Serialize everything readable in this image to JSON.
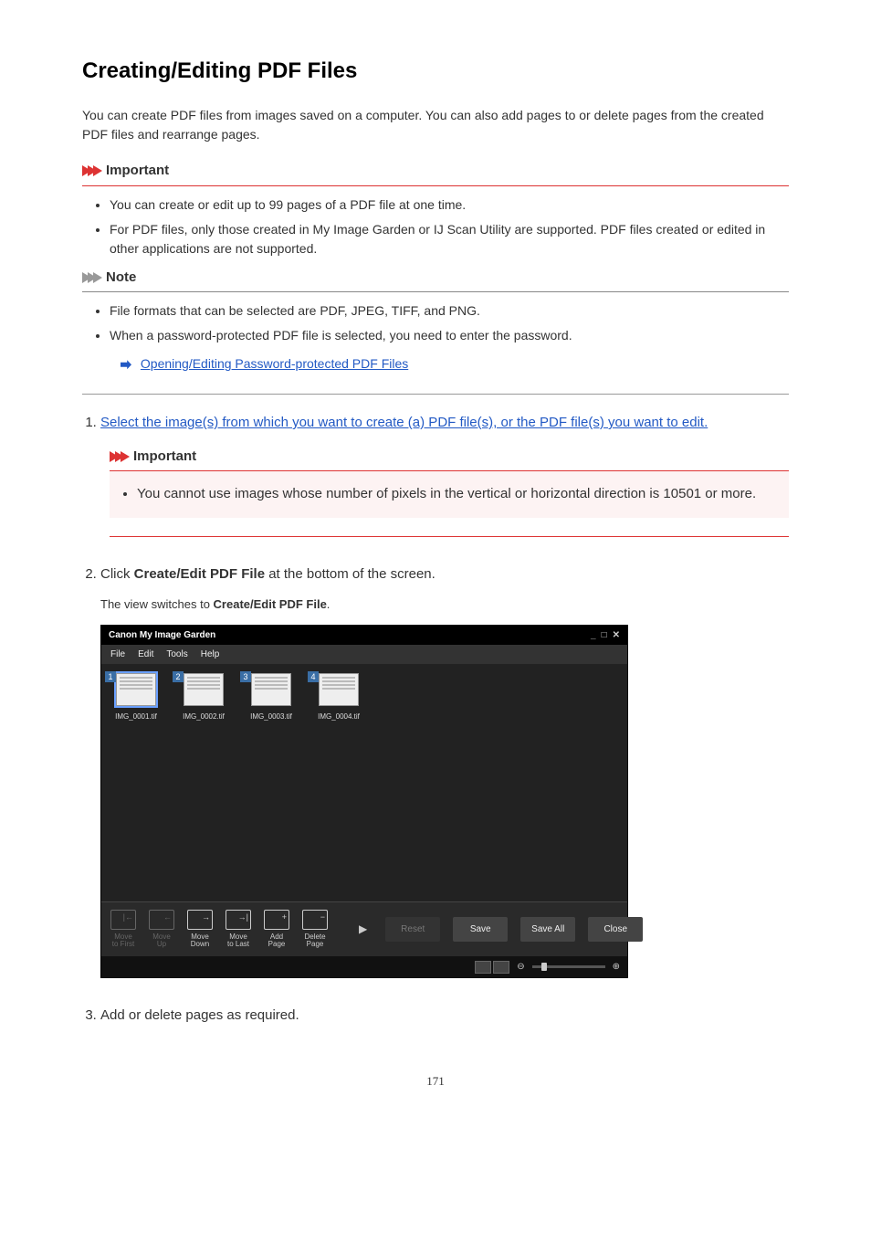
{
  "title": "Creating/Editing PDF Files",
  "intro": "You can create PDF files from images saved on a computer. You can also add pages to or delete pages from the created PDF files and rearrange pages.",
  "important": {
    "heading": "Important",
    "items": [
      "You can create or edit up to 99 pages of a PDF file at one time.",
      "For PDF files, only those created in My Image Garden or IJ Scan Utility are supported. PDF files created or edited in other applications are not supported."
    ]
  },
  "note": {
    "heading": "Note",
    "items": [
      "File formats that can be selected are PDF, JPEG, TIFF, and PNG.",
      "When a password-protected PDF file is selected, you need to enter the password."
    ],
    "link": "Opening/Editing Password-protected PDF Files"
  },
  "steps": {
    "s1": {
      "text": "Select the image(s) from which you want to create (a) PDF file(s), or the PDF file(s) you want to edit.",
      "important_heading": "Important",
      "important_item": "You cannot use images whose number of pixels in the vertical or horizontal direction is 10501 or more."
    },
    "s2": {
      "prefix": "Click ",
      "bold1": "Create/Edit PDF File",
      "suffix": " at the bottom of the screen.",
      "sub_prefix": "The view switches to ",
      "sub_bold": "Create/Edit PDF File",
      "sub_suffix": "."
    },
    "s3": {
      "text": "Add or delete pages as required."
    }
  },
  "app": {
    "title": "Canon My Image Garden",
    "menu": {
      "file": "File",
      "edit": "Edit",
      "tools": "Tools",
      "help": "Help"
    },
    "thumbs": [
      {
        "num": "1",
        "name": "IMG_0001.tif"
      },
      {
        "num": "2",
        "name": "IMG_0002.tif"
      },
      {
        "num": "3",
        "name": "IMG_0003.tif"
      },
      {
        "num": "4",
        "name": "IMG_0004.tif"
      }
    ],
    "toolbar": {
      "move_first": "Move to First",
      "move_up": "Move Up",
      "move_down": "Move Down",
      "move_last": "Move to Last",
      "add_page": "Add Page",
      "delete_page": "Delete Page",
      "reset": "Reset",
      "save": "Save",
      "save_all": "Save All",
      "close": "Close"
    }
  },
  "page_number": "171"
}
